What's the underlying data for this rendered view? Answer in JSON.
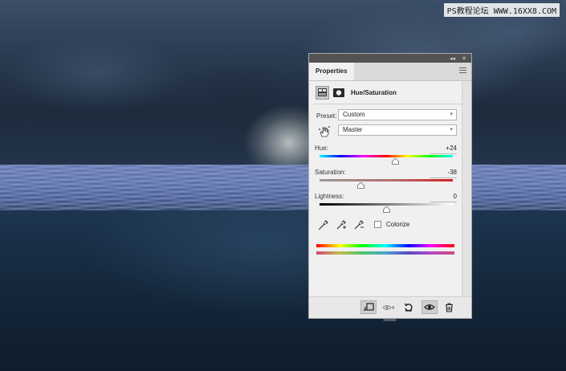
{
  "watermark": "PS教程论坛 WWW.16XX8.COM",
  "panel": {
    "tab_label": "Properties",
    "collapse_glyph": "◂◂",
    "close_glyph": "✕",
    "title": "Hue/Saturation",
    "preset_label": "Preset:",
    "preset_value": "Custom",
    "channel_value": "Master",
    "hue_label": "Hue:",
    "hue_value": "+24",
    "saturation_label": "Saturation:",
    "saturation_value": "-38",
    "lightness_label": "Lightness:",
    "lightness_value": "0",
    "colorize_label": "Colorize",
    "colorize_checked": false
  },
  "sliders": {
    "hue": {
      "value": 24,
      "min": -180,
      "max": 180
    },
    "saturation": {
      "value": -38,
      "min": -100,
      "max": 100
    },
    "lightness": {
      "value": 0,
      "min": -100,
      "max": 100
    }
  },
  "icons": {
    "adjustment": "hue-saturation-adjustment-icon",
    "mask": "layer-mask-icon",
    "on_image": "on-image-adjustment-hand-icon",
    "eyedropper": "eyedropper-icon",
    "eyedropper_add": "eyedropper-add-icon",
    "eyedropper_subtract": "eyedropper-subtract-icon",
    "clip": "clip-to-layer-icon",
    "view_previous": "view-previous-state-icon",
    "reset": "reset-icon",
    "visibility": "eye-icon",
    "delete": "trash-icon"
  }
}
